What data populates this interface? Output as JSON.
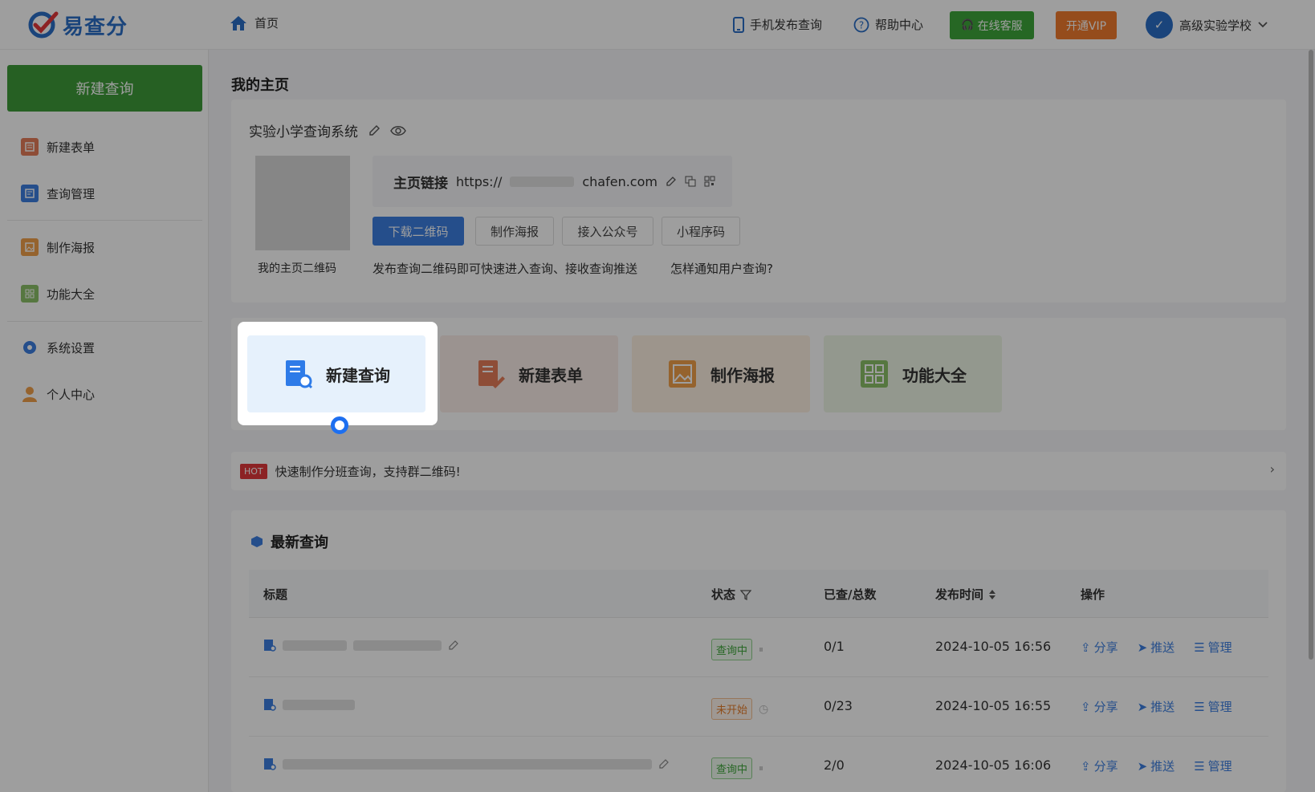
{
  "header": {
    "logo_text": "易查分",
    "home_label": "首页",
    "mobile_publish_label": "手机发布查询",
    "help_label": "帮助中心",
    "service_label": "在线客服",
    "vip_label": "开通VIP",
    "school_name": "高级实验学校"
  },
  "sidebar": {
    "new_query_button": "新建查询",
    "items": [
      {
        "label": "新建表单",
        "icon": "form-icon",
        "color": "#e57d5a"
      },
      {
        "label": "查询管理",
        "icon": "query-manage-icon",
        "color": "#3c7fe0"
      },
      {
        "label": "制作海报",
        "icon": "poster-icon",
        "color": "#f0a04b"
      },
      {
        "label": "功能大全",
        "icon": "features-icon",
        "color": "#8cc068"
      },
      {
        "label": "系统设置",
        "icon": "settings-icon",
        "color": "#3c7fe0"
      },
      {
        "label": "个人中心",
        "icon": "user-icon",
        "color": "#f0a04b"
      }
    ]
  },
  "main": {
    "page_title": "我的主页",
    "site_name": "实验小学查询系统",
    "qr_label": "我的主页二维码",
    "link_label": "主页链接",
    "link_prefix": "https://",
    "link_suffix": "chafen.com",
    "buttons": {
      "download_qr": "下载二维码",
      "make_poster": "制作海报",
      "connect_official": "接入公众号",
      "mini_program": "小程序码"
    },
    "tip_text": "发布查询二维码即可快速进入查询、接收查询推送",
    "tip_link": "怎样通知用户查询?",
    "quick_actions": [
      {
        "label": "新建查询",
        "icon": "new-query-icon",
        "color": "#2e7be8"
      },
      {
        "label": "新建表单",
        "icon": "new-form-icon",
        "color": "#e57d5a"
      },
      {
        "label": "制作海报",
        "icon": "make-poster-icon",
        "color": "#f0a04b"
      },
      {
        "label": "功能大全",
        "icon": "all-features-icon",
        "color": "#8cc068"
      }
    ],
    "hot_badge": "HOT",
    "hot_text": "快速制作分班查询，支持群二维码!"
  },
  "latest": {
    "title": "最新查询",
    "columns": [
      "标题",
      "状态",
      "已查/总数",
      "发布时间",
      "操作"
    ],
    "rows": [
      {
        "status": "查询中",
        "status_type": "going",
        "count": "0/1",
        "time": "2024-10-05 16:56"
      },
      {
        "status": "未开始",
        "status_type": "pending",
        "count": "0/23",
        "time": "2024-10-05 16:55"
      },
      {
        "status": "查询中",
        "status_type": "going",
        "count": "2/0",
        "time": "2024-10-05 16:06"
      }
    ],
    "ops": [
      "分享",
      "推送",
      "管理"
    ]
  }
}
